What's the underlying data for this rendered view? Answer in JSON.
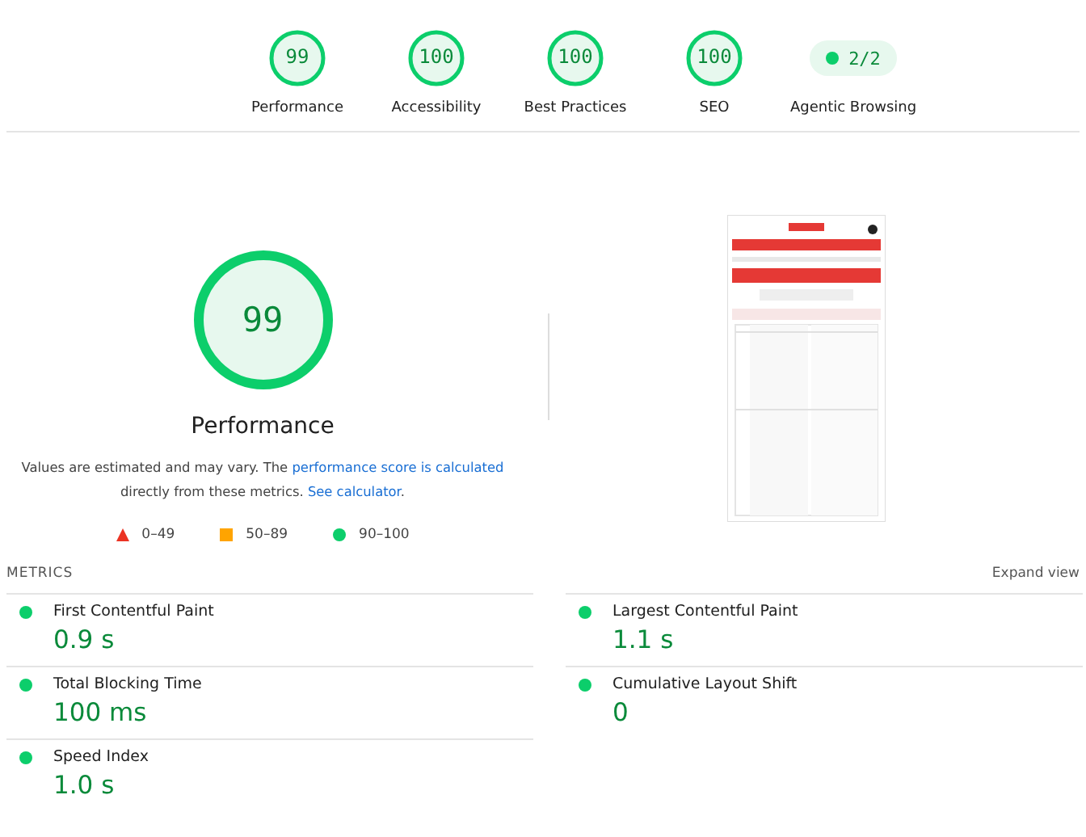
{
  "scores": [
    {
      "kind": "gauge",
      "value": "99",
      "label": "Performance",
      "color": "#0cce6b"
    },
    {
      "kind": "gauge",
      "value": "100",
      "label": "Accessibility",
      "color": "#0cce6b"
    },
    {
      "kind": "gauge",
      "value": "100",
      "label": "Best Practices",
      "color": "#0cce6b"
    },
    {
      "kind": "gauge",
      "value": "100",
      "label": "SEO",
      "color": "#0cce6b"
    },
    {
      "kind": "pill",
      "value": "2/2",
      "label": "Agentic Browsing",
      "color": "#0cce6b"
    }
  ],
  "performance": {
    "value": "99",
    "color": "#0cce6b",
    "title": "Performance",
    "note": "Values are estimated and may vary. The ",
    "note_link": "performance score is calculated",
    "note_mid": " directly from these metrics. ",
    "note_link2": "See calculator",
    "note_end": ".",
    "legend": [
      {
        "kind": "triangle",
        "label": "0–49",
        "color": "#eb3323"
      },
      {
        "kind": "square",
        "label": "50–89",
        "color": "#ffa400"
      },
      {
        "kind": "circle",
        "label": "90–100",
        "color": "#0cce6b"
      }
    ]
  },
  "metrics": {
    "heading": "METRICS",
    "expand": "Expand view",
    "items": [
      {
        "name": "First Contentful Paint",
        "value": "0.9 s",
        "color": "#0cce6b"
      },
      {
        "name": "Largest Contentful Paint",
        "value": "1.1 s",
        "color": "#0cce6b"
      },
      {
        "name": "Total Blocking Time",
        "value": "100 ms",
        "color": "#0cce6b"
      },
      {
        "name": "Cumulative Layout Shift",
        "value": "0",
        "color": "#0cce6b"
      },
      {
        "name": "Speed Index",
        "value": "1.0 s",
        "color": "#0cce6b"
      }
    ]
  }
}
